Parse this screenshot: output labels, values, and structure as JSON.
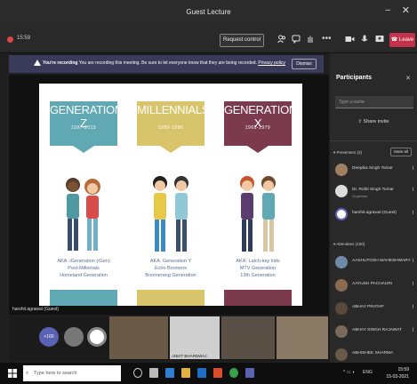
{
  "window": {
    "title": "Guest Lecture"
  },
  "controls": {
    "timer": "15:59",
    "request_control": "Request control",
    "leave": "Leave"
  },
  "banner": {
    "bold": "You're recording",
    "text": "You are recording this meeting. Be sure to let everyone know that they are being recorded.",
    "link": "Privacy policy",
    "dismiss": "Dismiss"
  },
  "slide": {
    "generations": [
      {
        "name": "GENERATION Z",
        "years": "1997-2015",
        "color": "#5fa8b4",
        "aka": [
          "AKA: iGeneration (iGen)",
          "Post-Millenials",
          "Homeland Generation"
        ]
      },
      {
        "name": "MILLENNIALS",
        "years": "1980-1996",
        "color": "#d8c46a",
        "aka": [
          "AKA: Generation Y",
          "Echo Boomers",
          "Boomerang Generation"
        ]
      },
      {
        "name": "GENERATION X",
        "years": "1965-1979",
        "color": "#7c3a4e",
        "aka": [
          "AKA: Latch-key kids",
          "MTV Generation",
          "13th Generation"
        ]
      }
    ],
    "presenter_tag": "harshit.agrawal (Guest)"
  },
  "strip": {
    "more_count": "+166",
    "tiles": [
      "",
      "ANKIT BHARDWAJ",
      "",
      ""
    ]
  },
  "panel": {
    "title": "Participants",
    "search_placeholder": "Type a name",
    "share_invite": "Share invite",
    "presenters_label": "Presenters (3)",
    "mute_all": "Mute all",
    "presenters": [
      {
        "name": "Deepika Singh Tomar",
        "role": ""
      },
      {
        "name": "Dr. Rohit Singh Tomar",
        "role": "Organiser"
      },
      {
        "name": "harshit.agrawal (Guest)",
        "role": ""
      }
    ],
    "attendees_label": "Attendees (150)",
    "attendees": [
      {
        "name": "AASHUTOSH MAHESHWARY"
      },
      {
        "name": "AAYUSH PACHAURI"
      },
      {
        "name": "ABHAY PRATAP"
      },
      {
        "name": "ABHAY SINGH RAJAWAT"
      },
      {
        "name": "ABHISHEK SHARMA"
      }
    ]
  },
  "taskbar": {
    "search_placeholder": "Type here to search",
    "time": "15:59",
    "date": "15-03-2021",
    "lang": "ENG"
  }
}
